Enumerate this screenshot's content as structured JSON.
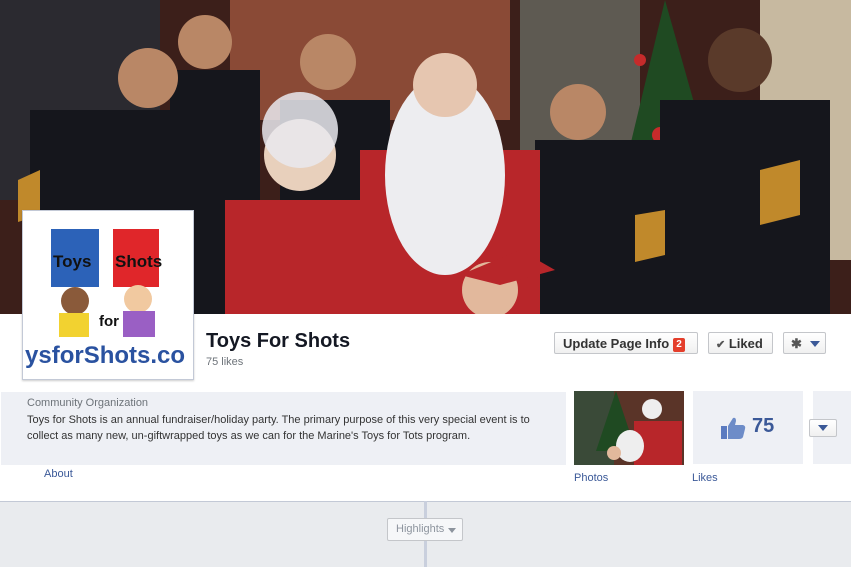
{
  "page": {
    "name": "Toys For Shots",
    "likes_line": "75 likes",
    "category": "Community Organization",
    "description": "Toys for Shots is an annual fundraiser/holiday party. The primary purpose of this very special event is to collect as many new, un-giftwrapped toys as we can for the Marine's Toys for Tots program."
  },
  "logo": {
    "line1a": "Toys",
    "line1b": "Shots",
    "line2": "for",
    "line3": "ysforShots.co"
  },
  "actions": {
    "update_label": "Update Page Info",
    "update_badge": "2",
    "liked_label": "Liked"
  },
  "tabs": {
    "about_label": "About",
    "photos_label": "Photos",
    "likes_label": "Likes",
    "likes_count": "75"
  },
  "timeline": {
    "highlights_label": "Highlights"
  },
  "icons": [
    "checkmark-icon",
    "gear-icon",
    "chevron-down-icon",
    "thumbs-up-icon"
  ],
  "colors": {
    "link": "#3b5998",
    "badge": "#e43e2b"
  }
}
